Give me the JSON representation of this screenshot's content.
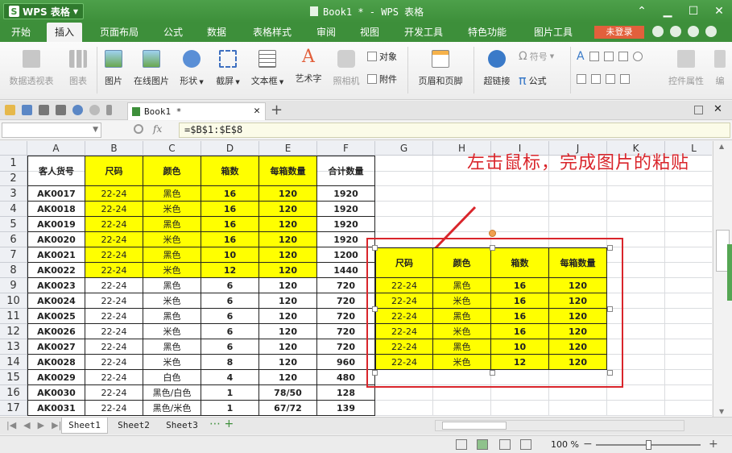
{
  "app": {
    "name": "WPS 表格",
    "window_title": "Book1 * - WPS 表格"
  },
  "menu": {
    "tabs": [
      "开始",
      "插入",
      "页面布局",
      "公式",
      "数据",
      "表格样式",
      "审阅",
      "视图",
      "开发工具",
      "特色功能",
      "图片工具"
    ],
    "active_tab": "插入",
    "login_label": "未登录"
  },
  "ribbon": {
    "pivot_table": "数据透视表",
    "chart": "图表",
    "picture": "图片",
    "online_picture": "在线图片",
    "shapes": "形状",
    "screenshot": "截屏",
    "text_box": "文本框",
    "word_art": "艺术字",
    "camera": "照相机",
    "object": "对象",
    "attachment": "附件",
    "header_footer": "页眉和页脚",
    "hyperlink": "超链接",
    "symbol": "符号",
    "formula": "公式",
    "control_props": "控件属性",
    "edit_short": "编"
  },
  "doc_tab": {
    "name": "Book1 *"
  },
  "formula_bar": {
    "name_box": "",
    "fx_label": "fx",
    "formula": "=$B$1:$E$8"
  },
  "grid": {
    "columns": [
      "A",
      "B",
      "C",
      "D",
      "E",
      "F",
      "G",
      "H",
      "I",
      "J",
      "K",
      "L"
    ],
    "row_numbers": [
      "1",
      "2",
      "3",
      "4",
      "5",
      "6",
      "7",
      "8",
      "9",
      "10",
      "11",
      "12",
      "13",
      "14",
      "15",
      "16",
      "17"
    ],
    "headers": [
      "客人货号",
      "尺码",
      "颜色",
      "箱数",
      "每箱数量",
      "合计数量"
    ],
    "rows": [
      [
        "AK0017",
        "22-24",
        "黑色",
        "16",
        "120",
        "1920"
      ],
      [
        "AK0018",
        "22-24",
        "米色",
        "16",
        "120",
        "1920"
      ],
      [
        "AK0019",
        "22-24",
        "黑色",
        "16",
        "120",
        "1920"
      ],
      [
        "AK0020",
        "22-24",
        "米色",
        "16",
        "120",
        "1920"
      ],
      [
        "AK0021",
        "22-24",
        "黑色",
        "10",
        "120",
        "1200"
      ],
      [
        "AK0022",
        "22-24",
        "米色",
        "12",
        "120",
        "1440"
      ],
      [
        "AK0023",
        "22-24",
        "黑色",
        "6",
        "120",
        "720"
      ],
      [
        "AK0024",
        "22-24",
        "米色",
        "6",
        "120",
        "720"
      ],
      [
        "AK0025",
        "22-24",
        "黑色",
        "6",
        "120",
        "720"
      ],
      [
        "AK0026",
        "22-24",
        "米色",
        "6",
        "120",
        "720"
      ],
      [
        "AK0027",
        "22-24",
        "黑色",
        "6",
        "120",
        "720"
      ],
      [
        "AK0028",
        "22-24",
        "米色",
        "8",
        "120",
        "960"
      ],
      [
        "AK0029",
        "22-24",
        "白色",
        "4",
        "120",
        "480"
      ],
      [
        "AK0030",
        "22-24",
        "黑色/白色",
        "1",
        "78/50",
        "128"
      ],
      [
        "AK0031",
        "22-24",
        "黑色/米色",
        "1",
        "67/72",
        "139"
      ]
    ],
    "highlight_color": "#ffff00"
  },
  "picture": {
    "headers": [
      "尺码",
      "颜色",
      "箱数",
      "每箱数量"
    ],
    "rows": [
      [
        "22-24",
        "黑色",
        "16",
        "120"
      ],
      [
        "22-24",
        "米色",
        "16",
        "120"
      ],
      [
        "22-24",
        "黑色",
        "16",
        "120"
      ],
      [
        "22-24",
        "米色",
        "16",
        "120"
      ],
      [
        "22-24",
        "黑色",
        "10",
        "120"
      ],
      [
        "22-24",
        "米色",
        "12",
        "120"
      ]
    ]
  },
  "annotation": {
    "text": "左击鼠标，完成图片的粘贴",
    "color": "#d9252b"
  },
  "sheets": {
    "tabs": [
      "Sheet1",
      "Sheet2",
      "Sheet3"
    ],
    "active": "Sheet1"
  },
  "status": {
    "zoom": "100 %"
  },
  "colors": {
    "brand_green": "#3d8f3a",
    "login_orange": "#e2603c"
  }
}
